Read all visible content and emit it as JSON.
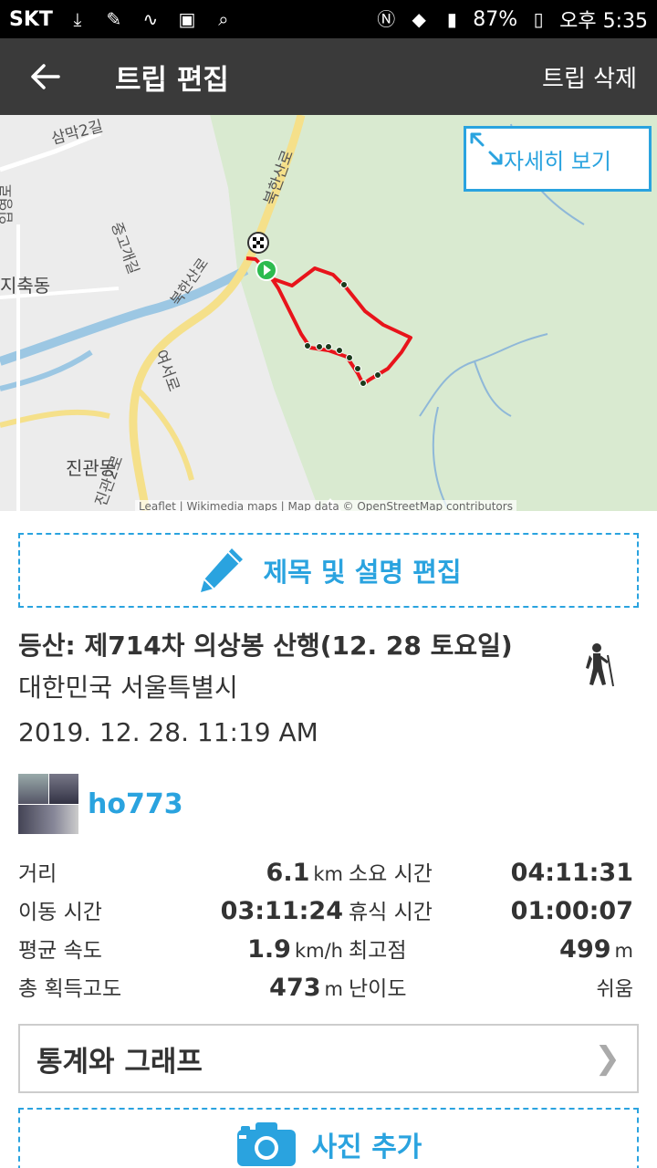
{
  "status_bar": {
    "carrier": "SKT",
    "battery": "87%",
    "time": "오후 5:35"
  },
  "app_bar": {
    "title": "트립 편집",
    "delete_label": "트립 삭제"
  },
  "map": {
    "detail_label": "자세히 보기",
    "attribution": "Leaflet | Wikimedia maps | Map data © OpenStreetMap contributors",
    "labels": {
      "samak": "삼막2길",
      "bukhansanro": "북한산로",
      "jichuk": "지축동",
      "jinkwan": "진관동",
      "yeoseo": "여서로",
      "jingwanro": "진관2로",
      "jeungo": "중고개길",
      "bukhansanro2": "북한산로",
      "ipeo": "입영로"
    },
    "colors": {
      "track": "#e8141b",
      "forest": "#d9ead0",
      "water": "#9cc7e3",
      "accent": "#2aa3df"
    }
  },
  "edit": {
    "label": "제목 및 설명 편집"
  },
  "trip": {
    "title": "등산: 제714차 의상봉 산행(12. 28 토요일)",
    "location": "대한민국 서울특별시",
    "datetime": "2019. 12. 28. 11:19 AM",
    "activity_icon": "hiker-icon"
  },
  "user": {
    "name": "ho773"
  },
  "stats": {
    "distance_label": "거리",
    "distance_value": "6.1",
    "distance_unit": "km",
    "duration_label": "소요 시간",
    "duration_value": "04:11:31",
    "moving_label": "이동 시간",
    "moving_value": "03:11:24",
    "rest_label": "휴식 시간",
    "rest_value": "01:00:07",
    "speed_label": "평균 속도",
    "speed_value": "1.9",
    "speed_unit": "km/h",
    "max_alt_label": "최고점",
    "max_alt_value": "499",
    "max_alt_unit": "m",
    "gain_label": "총 획득고도",
    "gain_value": "473",
    "gain_unit": "m",
    "difficulty_label": "난이도",
    "difficulty_value": "쉬움"
  },
  "stats_graph": {
    "label": "통계와 그래프",
    "chevron": "❯"
  },
  "photo": {
    "label": "사진 추가"
  }
}
